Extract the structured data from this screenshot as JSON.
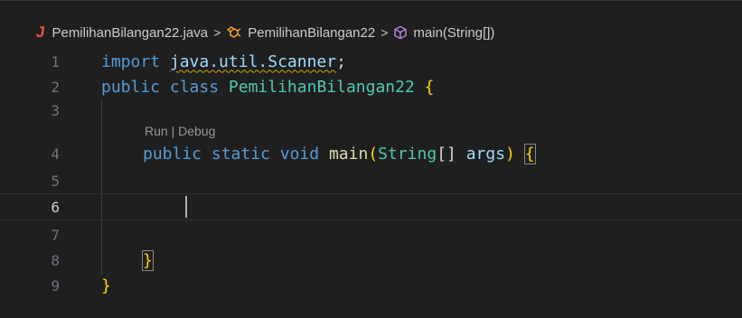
{
  "breadcrumb": {
    "file": "PemilihanBilangan22.java",
    "class_name": "PemilihanBilangan22",
    "method": "main(String[])",
    "separator": ">",
    "file_icon": "J"
  },
  "code_lens": {
    "text": "Run | Debug"
  },
  "gutter": {
    "numbers": [
      "1",
      "2",
      "3",
      "4",
      "5",
      "6",
      "7",
      "8",
      "9"
    ]
  },
  "code": {
    "l1_import": "import",
    "l1_pkg": "java.util.Scanner",
    "l1_semi": ";",
    "l2_public": "public",
    "l2_class": "class",
    "l2_name": "PemilihanBilangan22",
    "l2_brace": "{",
    "l4_public": "public",
    "l4_static": "static",
    "l4_void": "void",
    "l4_main": "main",
    "l4_open": "(",
    "l4_type": "String",
    "l4_arr": "[]",
    "l4_args": "args",
    "l4_close": ")",
    "l4_brace": "{",
    "l8_brace": "}",
    "l9_brace": "}"
  },
  "colors": {
    "background": "#1f1f1f",
    "keyword": "#569cd6",
    "type": "#4ec9b0",
    "function": "#dcdcaa",
    "variable": "#9cdcfe",
    "bracket": "#ffd700",
    "java_icon": "#f0524a",
    "class_icon": "#ee9d28",
    "method_icon": "#b180d7"
  },
  "icons": [
    "java-file-icon",
    "class-icon",
    "method-cube-icon"
  ]
}
